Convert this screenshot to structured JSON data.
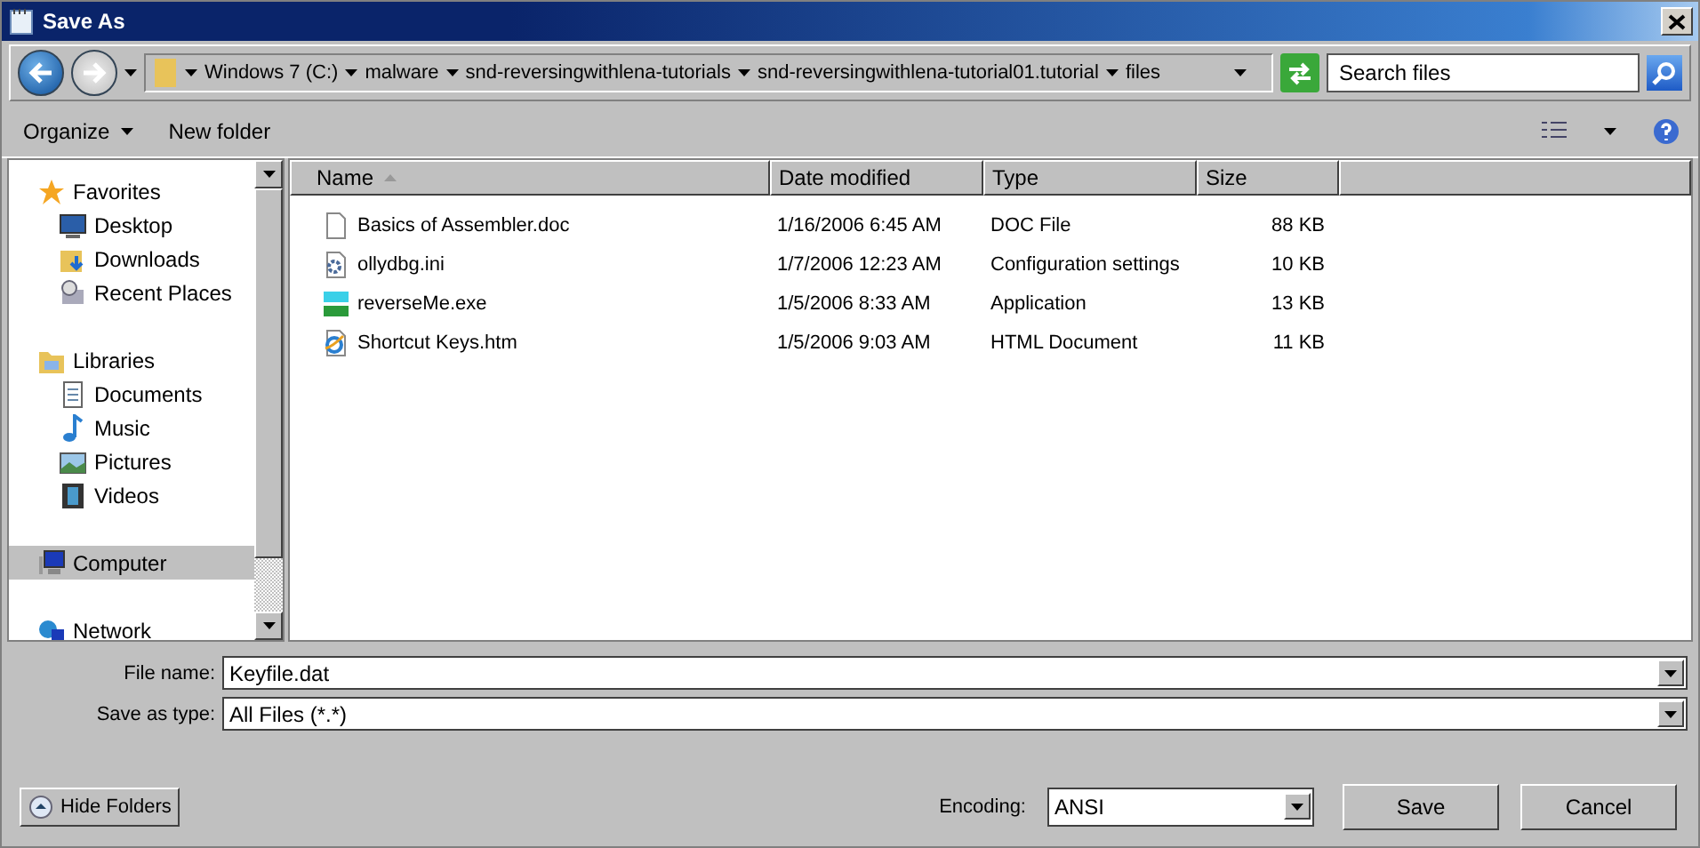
{
  "window": {
    "title": "Save As"
  },
  "address_bar": {
    "crumbs": [
      "Windows 7 (C:)",
      "malware",
      "snd-reversingwithlena-tutorials",
      "snd-reversingwithlena-tutorial01.tutorial",
      "files"
    ]
  },
  "search": {
    "placeholder": "Search files"
  },
  "toolbar": {
    "organize": "Organize",
    "new_folder": "New folder"
  },
  "sidebar": {
    "items": [
      {
        "label": "Favorites",
        "kind": "star",
        "selected": false,
        "children": [
          {
            "label": "Desktop",
            "kind": "desktop",
            "selected": false
          },
          {
            "label": "Downloads",
            "kind": "downloads",
            "selected": false
          },
          {
            "label": "Recent Places",
            "kind": "recent",
            "selected": false
          }
        ]
      },
      {
        "label": "Libraries",
        "kind": "library",
        "selected": false,
        "children": [
          {
            "label": "Documents",
            "kind": "document",
            "selected": false
          },
          {
            "label": "Music",
            "kind": "music",
            "selected": false
          },
          {
            "label": "Pictures",
            "kind": "pictures",
            "selected": false
          },
          {
            "label": "Videos",
            "kind": "videos",
            "selected": false
          }
        ]
      },
      {
        "label": "Computer",
        "kind": "computer",
        "selected": true
      },
      {
        "label": "Network",
        "kind": "network",
        "selected": false
      }
    ]
  },
  "table": {
    "columns": [
      {
        "label": "Name",
        "sorted": true
      },
      {
        "label": "Date modified",
        "sorted": false
      },
      {
        "label": "Type",
        "sorted": false
      },
      {
        "label": "Size",
        "sorted": false
      }
    ],
    "rows": [
      {
        "kind": "doc",
        "name": "Basics of Assembler.doc",
        "date": "1/16/2006 6:45 AM",
        "type": "DOC File",
        "size": "88 KB"
      },
      {
        "kind": "ini",
        "name": "ollydbg.ini",
        "date": "1/7/2006 12:23 AM",
        "type": "Configuration settings",
        "size": "10 KB"
      },
      {
        "kind": "exe",
        "name": "reverseMe.exe",
        "date": "1/5/2006 8:33 AM",
        "type": "Application",
        "size": "13 KB"
      },
      {
        "kind": "htm",
        "name": "Shortcut Keys.htm",
        "date": "1/5/2006 9:03 AM",
        "type": "HTML Document",
        "size": "11 KB"
      }
    ]
  },
  "form": {
    "file_name_label": "File name:",
    "file_name": "Keyfile.dat",
    "type_label": "Save as type:",
    "type": "All Files  (*.*)"
  },
  "footer": {
    "hide_folders": "Hide Folders",
    "encoding_label": "Encoding:",
    "encoding": "ANSI",
    "save": "Save",
    "cancel": "Cancel"
  }
}
